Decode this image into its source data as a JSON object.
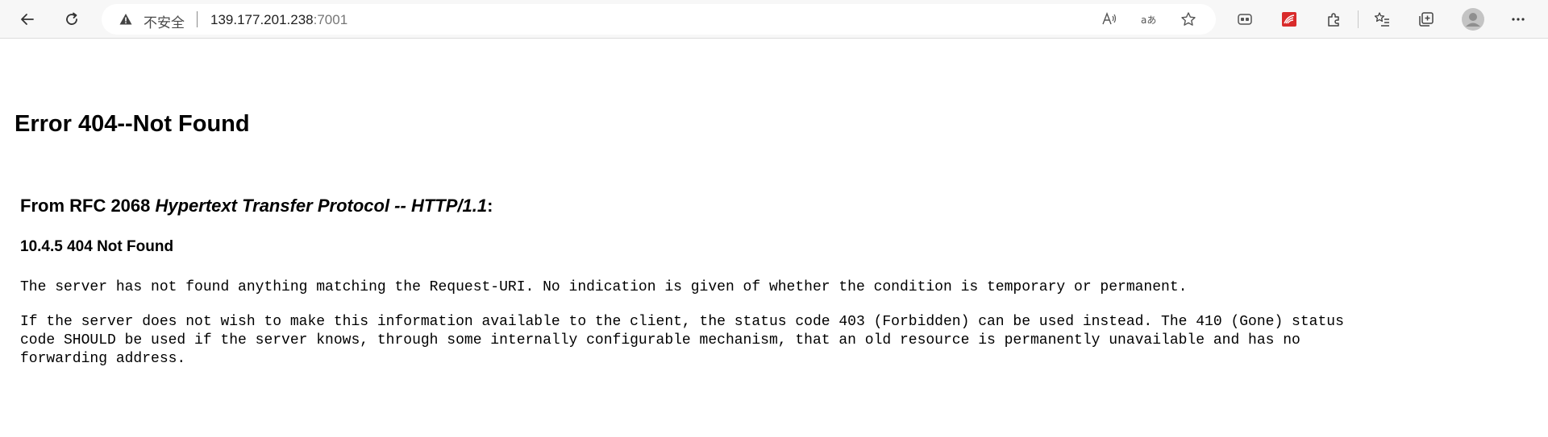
{
  "browser": {
    "security_label": "不安全",
    "url_host": "139.177.201.238",
    "url_port": ":7001"
  },
  "page": {
    "title": "Error 404--Not Found",
    "rfc_prefix": "From RFC 2068 ",
    "rfc_title": "Hypertext Transfer Protocol -- HTTP/1.1",
    "rfc_suffix": ":",
    "section_heading": "10.4.5 404 Not Found",
    "paragraph_1": "The server has not found anything matching the Request-URI. No indication is given of whether the condition is temporary or permanent.",
    "paragraph_2": "If the server does not wish to make this information available to the client, the status code 403 (Forbidden) can be used instead. The 410 (Gone) status\ncode SHOULD be used if the server knows, through some internally configurable mechanism, that an old resource is permanently unavailable and has no\nforwarding address."
  },
  "icons": {
    "back": "back-arrow-icon",
    "refresh": "refresh-icon",
    "warning": "warning-triangle-icon",
    "read_aloud": "read-aloud-icon",
    "translate": "translate-icon",
    "favorite": "star-icon",
    "games": "games-icon",
    "extension_red": "extension-red-icon",
    "extensions": "puzzle-icon",
    "favorites": "favorites-list-icon",
    "collections": "collections-icon",
    "profile": "profile-avatar-icon",
    "more": "more-dots-icon"
  }
}
